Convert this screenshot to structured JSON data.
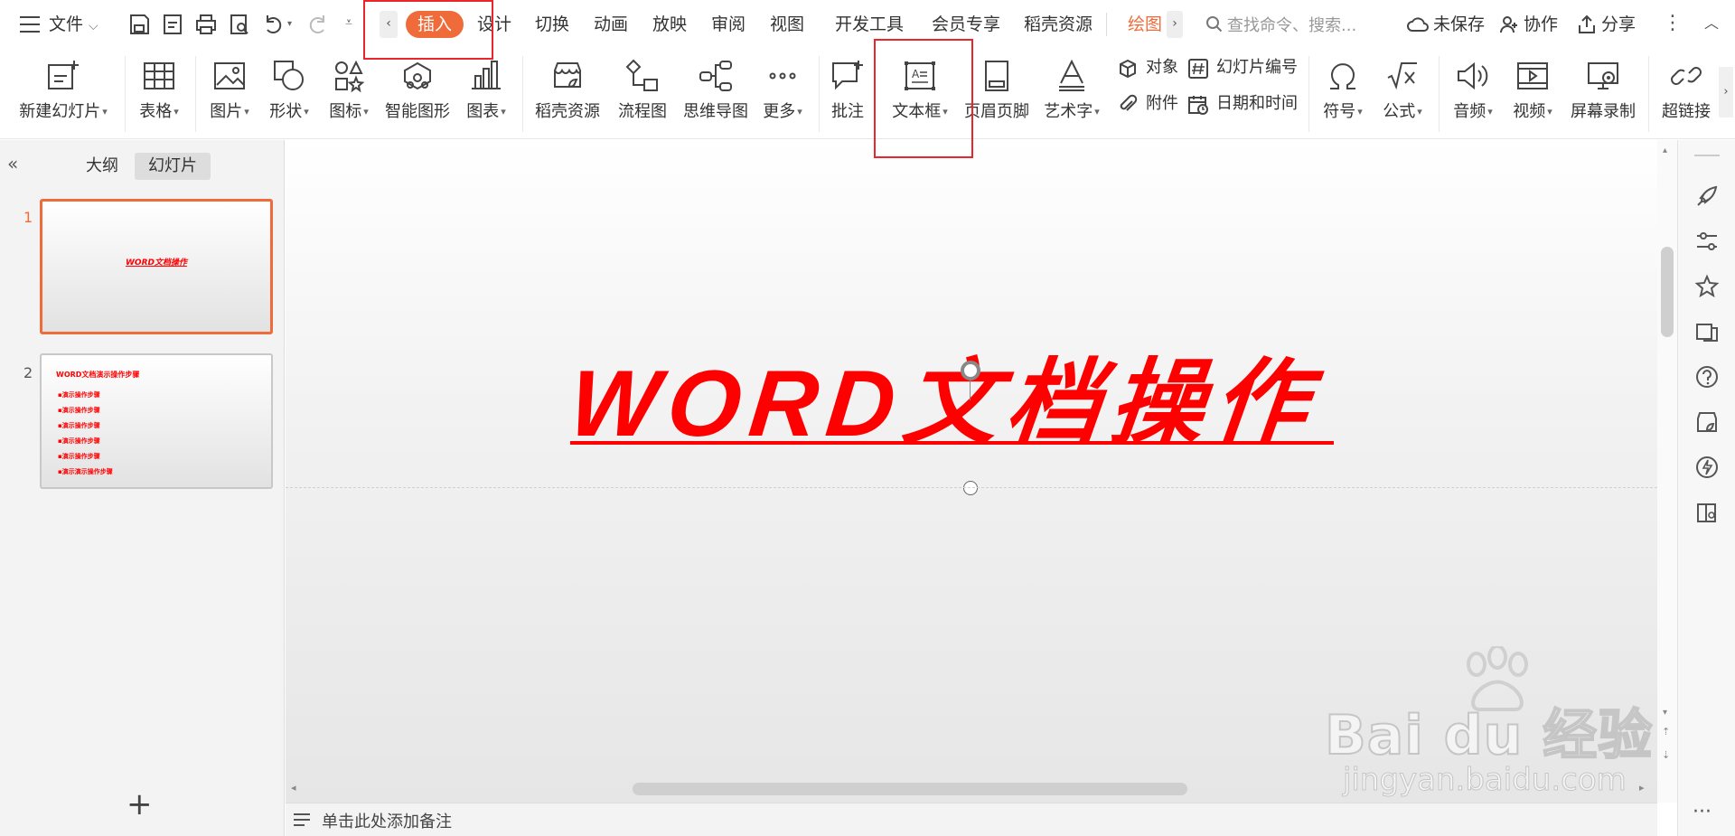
{
  "menubar": {
    "file": "文件",
    "tabs": [
      "插入",
      "设计",
      "切换",
      "动画",
      "放映",
      "审阅",
      "视图",
      "开发工具",
      "会员专享",
      "稻壳资源",
      "绘图"
    ],
    "active_tab": "插入",
    "search_placeholder": "查找命令、搜索...",
    "unsaved": "未保存",
    "collab": "协作",
    "share": "分享"
  },
  "ribbon": {
    "new_slide": "新建幻灯片",
    "table": "表格",
    "picture": "图片",
    "shape": "形状",
    "icon": "图标",
    "smart_graphic": "智能图形",
    "chart": "图表",
    "docer_resources": "稻壳资源",
    "flowchart": "流程图",
    "mindmap": "思维导图",
    "more": "更多",
    "comment": "批注",
    "textbox": "文本框",
    "header_footer": "页眉页脚",
    "wordart": "艺术字",
    "object": "对象",
    "attachment": "附件",
    "slide_number": "幻灯片编号",
    "date_time": "日期和时间",
    "symbol": "符号",
    "formula": "公式",
    "audio": "音频",
    "video": "视频",
    "screen_record": "屏幕录制",
    "hyperlink": "超链接"
  },
  "leftpane": {
    "tab_outline": "大纲",
    "tab_slides": "幻灯片",
    "slides": [
      {
        "number": "1",
        "title": "WORD文档操作"
      },
      {
        "number": "2",
        "title": "WORD文档演示操作步骤",
        "bullets": [
          "演示操作步骤",
          "演示操作步骤",
          "演示操作步骤",
          "演示操作步骤",
          "演示操作步骤",
          "演示演示操作步骤"
        ]
      }
    ],
    "add_slide": "+"
  },
  "canvas": {
    "title": "WORD文档操作",
    "title_color": "#ff0000"
  },
  "notes": {
    "placeholder": "单击此处添加备注"
  },
  "watermark": {
    "logo": "Bai du 经验",
    "url": "jingyan.baidu.com"
  },
  "colors": {
    "accent": "#ef6c3a",
    "highlight_box": "#e8262b"
  }
}
